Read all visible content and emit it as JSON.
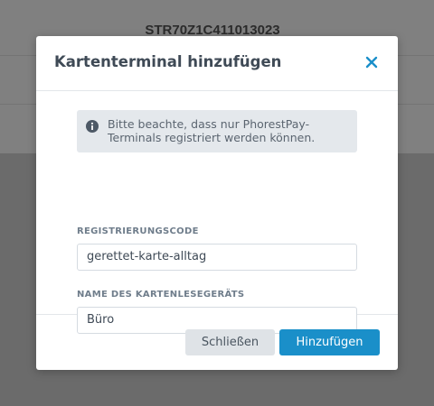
{
  "background": {
    "serial_number": "STR70Z1C411013023"
  },
  "modal": {
    "title": "Kartenterminal hinzufügen",
    "close_icon": "close-icon",
    "info": {
      "icon": "info-icon",
      "text": "Bitte beachte, dass nur PhorestPay-Terminals registriert werden können."
    },
    "registration_code": {
      "label": "REGISTRIERUNGSCODE",
      "value": "gerettet-karte-alltag"
    },
    "reader_name": {
      "label": "NAME DES KARTENLESEGERÄTS",
      "value": "Büro"
    },
    "buttons": {
      "close_label": "Schließen",
      "add_label": "Hinzufügen"
    }
  },
  "colors": {
    "accent": "#1a8fc9",
    "overlay": "#6b6b6b",
    "info_bg": "#e4e8ec"
  }
}
